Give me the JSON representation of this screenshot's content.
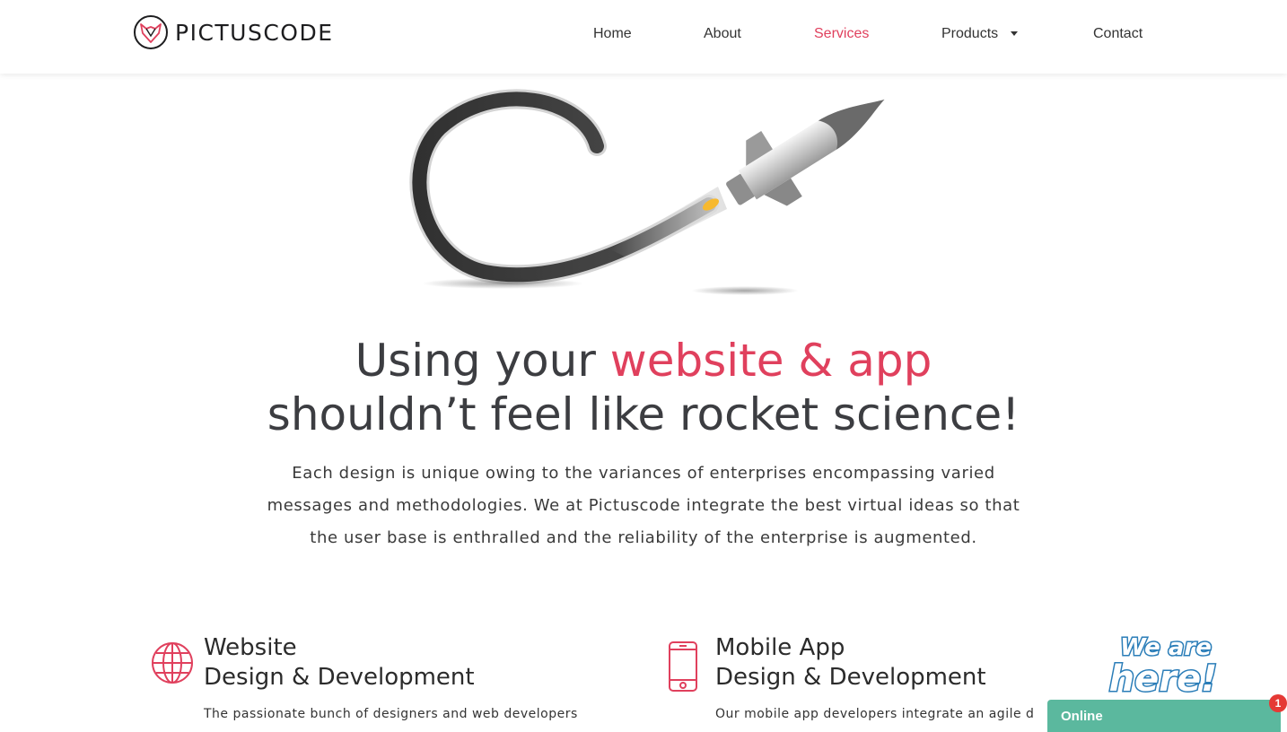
{
  "brand": {
    "name": "PICTUSCODE"
  },
  "nav": {
    "items": [
      {
        "label": "Home"
      },
      {
        "label": "About"
      },
      {
        "label": "Services"
      },
      {
        "label": "Products"
      },
      {
        "label": "Contact"
      }
    ],
    "active": "Services",
    "dropdown_item": "Products",
    "accent_color": "#e0405d"
  },
  "hero": {
    "headline_prefix": "Using your ",
    "headline_accent": "website & app",
    "headline_line2": "shouldn’t feel like rocket science!",
    "intro": "Each design is unique owing to the variances of enterprises encompassing varied messages and methodologies. We at Pictuscode integrate the best virtual ideas so that the user base is enthralled and the reliability of the enterprise is augmented."
  },
  "services": [
    {
      "icon": "globe-icon",
      "title_line1": "Website",
      "title_line2": "Design & Development",
      "description": "The passionate bunch of designers and web developers"
    },
    {
      "icon": "mobile-phone-icon",
      "title_line1": "Mobile App",
      "title_line2": "Design & Development",
      "description": "Our mobile app developers integrate an agile d"
    }
  ],
  "chat": {
    "banner": "We are here!",
    "status": "Online",
    "badge_count": "1",
    "color": "#5bb89e"
  }
}
